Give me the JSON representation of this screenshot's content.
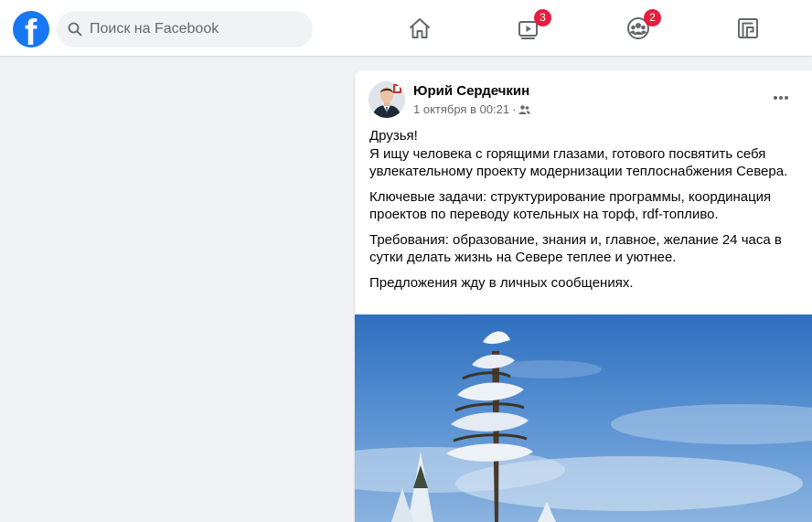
{
  "header": {
    "logo_letter": "f",
    "search_placeholder": "Поиск на Facebook",
    "nav": {
      "home_icon": "home-icon",
      "watch_icon": "video-play-icon",
      "watch_badge": "3",
      "groups_icon": "groups-icon",
      "groups_badge": "2",
      "gaming_icon": "gaming-icon"
    },
    "colors": {
      "brand": "#1877f2",
      "badge": "#e41e3f"
    }
  },
  "post": {
    "author": "Юрий Сердечкин",
    "date": "1 октября в 00:21",
    "separator": "·",
    "audience_icon": "friends-icon",
    "more_icon": "more-options-icon",
    "paragraphs": [
      "Друзья!\nЯ ищу человека с горящими глазами, готового посвятить себя увлекательному проекту модернизации теплоснабжения Севера.",
      "Ключевые задачи: структурирование программы, координация проектов по переводу котельных на торф, rdf-топливо.",
      "Требования: образование, знания и, главное, желание 24 часа в сутки делать жизнь на Севере теплее и уютнее.",
      "Предложения жду в личных сообщениях."
    ],
    "image": "snow-covered-pine-tree-photo"
  }
}
